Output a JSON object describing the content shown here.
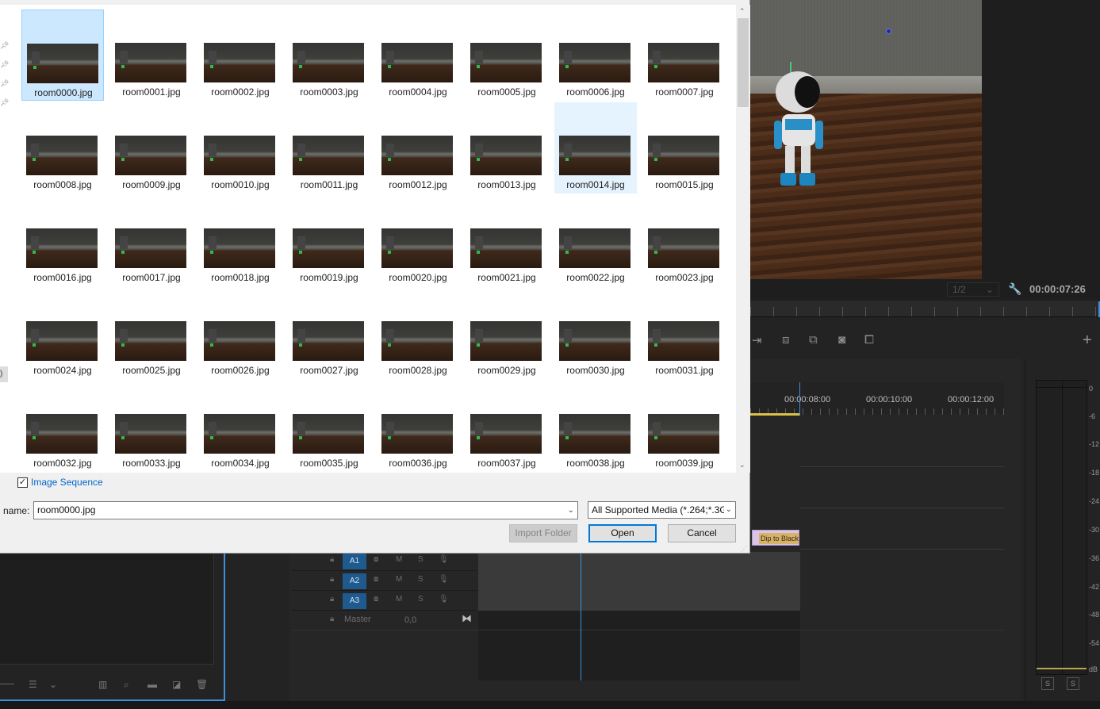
{
  "dialog": {
    "files": [
      "room0000.jpg",
      "room0001.jpg",
      "room0002.jpg",
      "room0003.jpg",
      "room0004.jpg",
      "room0005.jpg",
      "room0006.jpg",
      "room0007.jpg",
      "room0008.jpg",
      "room0009.jpg",
      "room0010.jpg",
      "room0011.jpg",
      "room0012.jpg",
      "room0013.jpg",
      "room0014.jpg",
      "room0015.jpg",
      "room0016.jpg",
      "room0017.jpg",
      "room0018.jpg",
      "room0019.jpg",
      "room0020.jpg",
      "room0021.jpg",
      "room0022.jpg",
      "room0023.jpg",
      "room0024.jpg",
      "room0025.jpg",
      "room0026.jpg",
      "room0027.jpg",
      "room0028.jpg",
      "room0029.jpg",
      "room0030.jpg",
      "room0031.jpg",
      "room0032.jpg",
      "room0033.jpg",
      "room0034.jpg",
      "room0035.jpg",
      "room0036.jpg",
      "room0037.jpg",
      "room0038.jpg",
      "room0039.jpg"
    ],
    "selected_file": "room0000.jpg",
    "hovered_file": "room0014.jpg",
    "image_sequence_label": "Image Sequence",
    "image_sequence_checked": true,
    "filename_label": "name:",
    "filename_value": "room0000.jpg",
    "filter_value": "All Supported Media (*.264;*.3G",
    "import_folder_label": "Import Folder",
    "open_label": "Open",
    "cancel_label": "Cancel",
    "nav_bracket": ")"
  },
  "program_monitor": {
    "zoom_value": "1/2",
    "timecode": "00:00:07:26"
  },
  "timeline": {
    "ruler_labels": [
      "00:00:08:00",
      "00:00:10:00",
      "00:00:12:00"
    ],
    "clip_label": "Dip to Black",
    "tracks": [
      {
        "name": "A1",
        "m": "M",
        "s": "S"
      },
      {
        "name": "A2",
        "m": "M",
        "s": "S"
      },
      {
        "name": "A3",
        "m": "M",
        "s": "S"
      }
    ],
    "master_label": "Master",
    "master_value": "0,0"
  },
  "audio_meter": {
    "db_labels": [
      "0",
      "-6",
      "-12",
      "-18",
      "-24",
      "-30",
      "-36",
      "-42",
      "-48",
      "-54",
      "dB"
    ],
    "solo_labels": [
      "S",
      "S"
    ]
  }
}
